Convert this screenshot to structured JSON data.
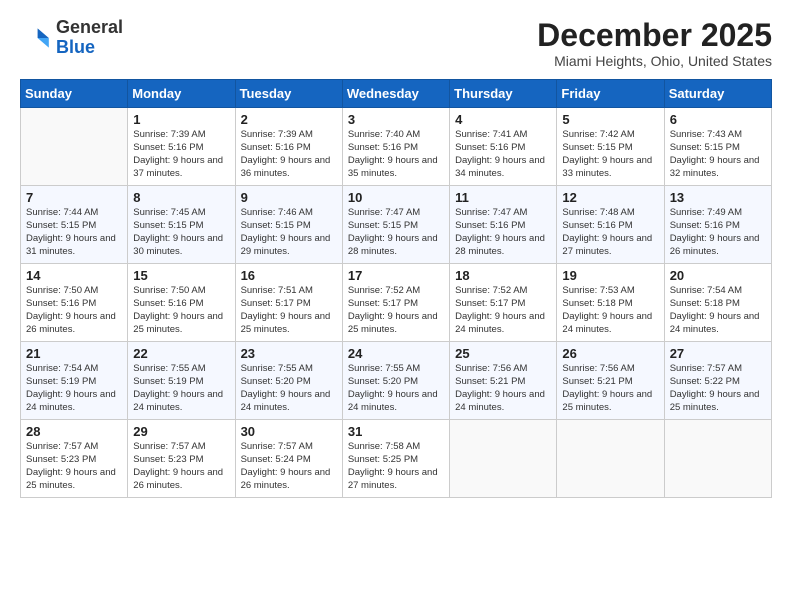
{
  "logo": {
    "general": "General",
    "blue": "Blue"
  },
  "title": "December 2025",
  "location": "Miami Heights, Ohio, United States",
  "headers": [
    "Sunday",
    "Monday",
    "Tuesday",
    "Wednesday",
    "Thursday",
    "Friday",
    "Saturday"
  ],
  "weeks": [
    [
      {
        "day": "",
        "sunrise": "",
        "sunset": "",
        "daylight": ""
      },
      {
        "day": "1",
        "sunrise": "Sunrise: 7:39 AM",
        "sunset": "Sunset: 5:16 PM",
        "daylight": "Daylight: 9 hours and 37 minutes."
      },
      {
        "day": "2",
        "sunrise": "Sunrise: 7:39 AM",
        "sunset": "Sunset: 5:16 PM",
        "daylight": "Daylight: 9 hours and 36 minutes."
      },
      {
        "day": "3",
        "sunrise": "Sunrise: 7:40 AM",
        "sunset": "Sunset: 5:16 PM",
        "daylight": "Daylight: 9 hours and 35 minutes."
      },
      {
        "day": "4",
        "sunrise": "Sunrise: 7:41 AM",
        "sunset": "Sunset: 5:16 PM",
        "daylight": "Daylight: 9 hours and 34 minutes."
      },
      {
        "day": "5",
        "sunrise": "Sunrise: 7:42 AM",
        "sunset": "Sunset: 5:15 PM",
        "daylight": "Daylight: 9 hours and 33 minutes."
      },
      {
        "day": "6",
        "sunrise": "Sunrise: 7:43 AM",
        "sunset": "Sunset: 5:15 PM",
        "daylight": "Daylight: 9 hours and 32 minutes."
      }
    ],
    [
      {
        "day": "7",
        "sunrise": "Sunrise: 7:44 AM",
        "sunset": "Sunset: 5:15 PM",
        "daylight": "Daylight: 9 hours and 31 minutes."
      },
      {
        "day": "8",
        "sunrise": "Sunrise: 7:45 AM",
        "sunset": "Sunset: 5:15 PM",
        "daylight": "Daylight: 9 hours and 30 minutes."
      },
      {
        "day": "9",
        "sunrise": "Sunrise: 7:46 AM",
        "sunset": "Sunset: 5:15 PM",
        "daylight": "Daylight: 9 hours and 29 minutes."
      },
      {
        "day": "10",
        "sunrise": "Sunrise: 7:47 AM",
        "sunset": "Sunset: 5:15 PM",
        "daylight": "Daylight: 9 hours and 28 minutes."
      },
      {
        "day": "11",
        "sunrise": "Sunrise: 7:47 AM",
        "sunset": "Sunset: 5:16 PM",
        "daylight": "Daylight: 9 hours and 28 minutes."
      },
      {
        "day": "12",
        "sunrise": "Sunrise: 7:48 AM",
        "sunset": "Sunset: 5:16 PM",
        "daylight": "Daylight: 9 hours and 27 minutes."
      },
      {
        "day": "13",
        "sunrise": "Sunrise: 7:49 AM",
        "sunset": "Sunset: 5:16 PM",
        "daylight": "Daylight: 9 hours and 26 minutes."
      }
    ],
    [
      {
        "day": "14",
        "sunrise": "Sunrise: 7:50 AM",
        "sunset": "Sunset: 5:16 PM",
        "daylight": "Daylight: 9 hours and 26 minutes."
      },
      {
        "day": "15",
        "sunrise": "Sunrise: 7:50 AM",
        "sunset": "Sunset: 5:16 PM",
        "daylight": "Daylight: 9 hours and 25 minutes."
      },
      {
        "day": "16",
        "sunrise": "Sunrise: 7:51 AM",
        "sunset": "Sunset: 5:17 PM",
        "daylight": "Daylight: 9 hours and 25 minutes."
      },
      {
        "day": "17",
        "sunrise": "Sunrise: 7:52 AM",
        "sunset": "Sunset: 5:17 PM",
        "daylight": "Daylight: 9 hours and 25 minutes."
      },
      {
        "day": "18",
        "sunrise": "Sunrise: 7:52 AM",
        "sunset": "Sunset: 5:17 PM",
        "daylight": "Daylight: 9 hours and 24 minutes."
      },
      {
        "day": "19",
        "sunrise": "Sunrise: 7:53 AM",
        "sunset": "Sunset: 5:18 PM",
        "daylight": "Daylight: 9 hours and 24 minutes."
      },
      {
        "day": "20",
        "sunrise": "Sunrise: 7:54 AM",
        "sunset": "Sunset: 5:18 PM",
        "daylight": "Daylight: 9 hours and 24 minutes."
      }
    ],
    [
      {
        "day": "21",
        "sunrise": "Sunrise: 7:54 AM",
        "sunset": "Sunset: 5:19 PM",
        "daylight": "Daylight: 9 hours and 24 minutes."
      },
      {
        "day": "22",
        "sunrise": "Sunrise: 7:55 AM",
        "sunset": "Sunset: 5:19 PM",
        "daylight": "Daylight: 9 hours and 24 minutes."
      },
      {
        "day": "23",
        "sunrise": "Sunrise: 7:55 AM",
        "sunset": "Sunset: 5:20 PM",
        "daylight": "Daylight: 9 hours and 24 minutes."
      },
      {
        "day": "24",
        "sunrise": "Sunrise: 7:55 AM",
        "sunset": "Sunset: 5:20 PM",
        "daylight": "Daylight: 9 hours and 24 minutes."
      },
      {
        "day": "25",
        "sunrise": "Sunrise: 7:56 AM",
        "sunset": "Sunset: 5:21 PM",
        "daylight": "Daylight: 9 hours and 24 minutes."
      },
      {
        "day": "26",
        "sunrise": "Sunrise: 7:56 AM",
        "sunset": "Sunset: 5:21 PM",
        "daylight": "Daylight: 9 hours and 25 minutes."
      },
      {
        "day": "27",
        "sunrise": "Sunrise: 7:57 AM",
        "sunset": "Sunset: 5:22 PM",
        "daylight": "Daylight: 9 hours and 25 minutes."
      }
    ],
    [
      {
        "day": "28",
        "sunrise": "Sunrise: 7:57 AM",
        "sunset": "Sunset: 5:23 PM",
        "daylight": "Daylight: 9 hours and 25 minutes."
      },
      {
        "day": "29",
        "sunrise": "Sunrise: 7:57 AM",
        "sunset": "Sunset: 5:23 PM",
        "daylight": "Daylight: 9 hours and 26 minutes."
      },
      {
        "day": "30",
        "sunrise": "Sunrise: 7:57 AM",
        "sunset": "Sunset: 5:24 PM",
        "daylight": "Daylight: 9 hours and 26 minutes."
      },
      {
        "day": "31",
        "sunrise": "Sunrise: 7:58 AM",
        "sunset": "Sunset: 5:25 PM",
        "daylight": "Daylight: 9 hours and 27 minutes."
      },
      {
        "day": "",
        "sunrise": "",
        "sunset": "",
        "daylight": ""
      },
      {
        "day": "",
        "sunrise": "",
        "sunset": "",
        "daylight": ""
      },
      {
        "day": "",
        "sunrise": "",
        "sunset": "",
        "daylight": ""
      }
    ]
  ]
}
